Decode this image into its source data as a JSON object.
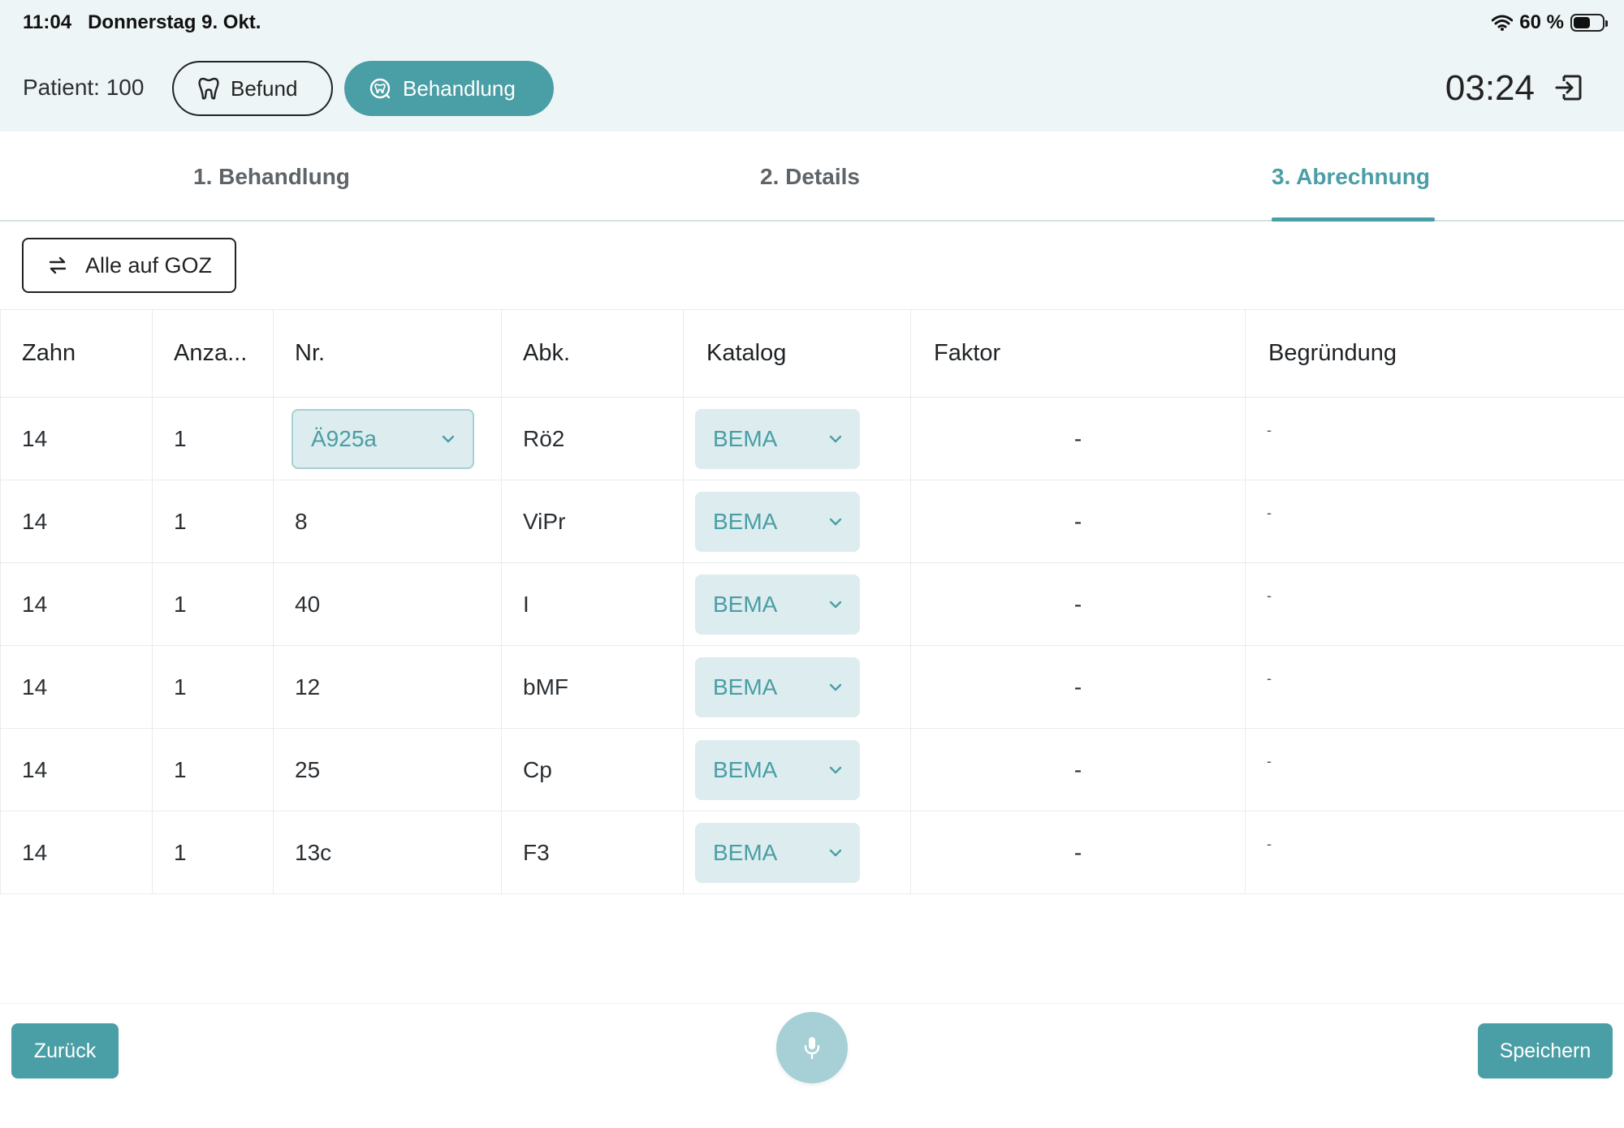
{
  "status_bar": {
    "time": "11:04",
    "date": "Donnerstag 9. Okt.",
    "battery": "60 %",
    "battery_level": 0.6
  },
  "header": {
    "patient_label": "Patient: 100",
    "befund_label": "Befund",
    "behandlung_label": "Behandlung",
    "timer": "03:24",
    "icons": {
      "befund": "tooth-icon",
      "behandlung": "tooth-circle-icon",
      "exit": "exit-icon"
    }
  },
  "tabs": [
    {
      "label": "1. Behandlung",
      "active": false
    },
    {
      "label": "2. Details",
      "active": false
    },
    {
      "label": "3. Abrechnung",
      "active": true
    }
  ],
  "toolbar": {
    "goz_label": "Alle auf GOZ",
    "goz_icon": "swap-arrows-icon"
  },
  "table": {
    "columns": [
      "Zahn",
      "Anza...",
      "Nr.",
      "Abk.",
      "Katalog",
      "Faktor",
      "Begründung"
    ],
    "rows": [
      {
        "zahn": "14",
        "anzahl": "1",
        "nr": "Ä925a",
        "abk": "Rö2",
        "katalog": "BEMA",
        "faktor": "-",
        "begruendung": "-"
      },
      {
        "zahn": "14",
        "anzahl": "1",
        "nr": "8",
        "abk": "ViPr",
        "katalog": "BEMA",
        "faktor": "-",
        "begruendung": "-"
      },
      {
        "zahn": "14",
        "anzahl": "1",
        "nr": "40",
        "abk": "I",
        "katalog": "BEMA",
        "faktor": "-",
        "begruendung": "-"
      },
      {
        "zahn": "14",
        "anzahl": "1",
        "nr": "12",
        "abk": "bMF",
        "katalog": "BEMA",
        "faktor": "-",
        "begruendung": "-"
      },
      {
        "zahn": "14",
        "anzahl": "1",
        "nr": "25",
        "abk": "Cp",
        "katalog": "BEMA",
        "faktor": "-",
        "begruendung": "-"
      },
      {
        "zahn": "14",
        "anzahl": "1",
        "nr": "13c",
        "abk": "F3",
        "katalog": "BEMA",
        "faktor": "-",
        "begruendung": "-"
      }
    ]
  },
  "footer": {
    "back_label": "Zurück",
    "save_label": "Speichern",
    "mic_icon": "microphone-icon"
  },
  "colors": {
    "accent": "#4a9ea5",
    "header_bg": "#eef5f6",
    "select_bg": "#ddecee"
  }
}
